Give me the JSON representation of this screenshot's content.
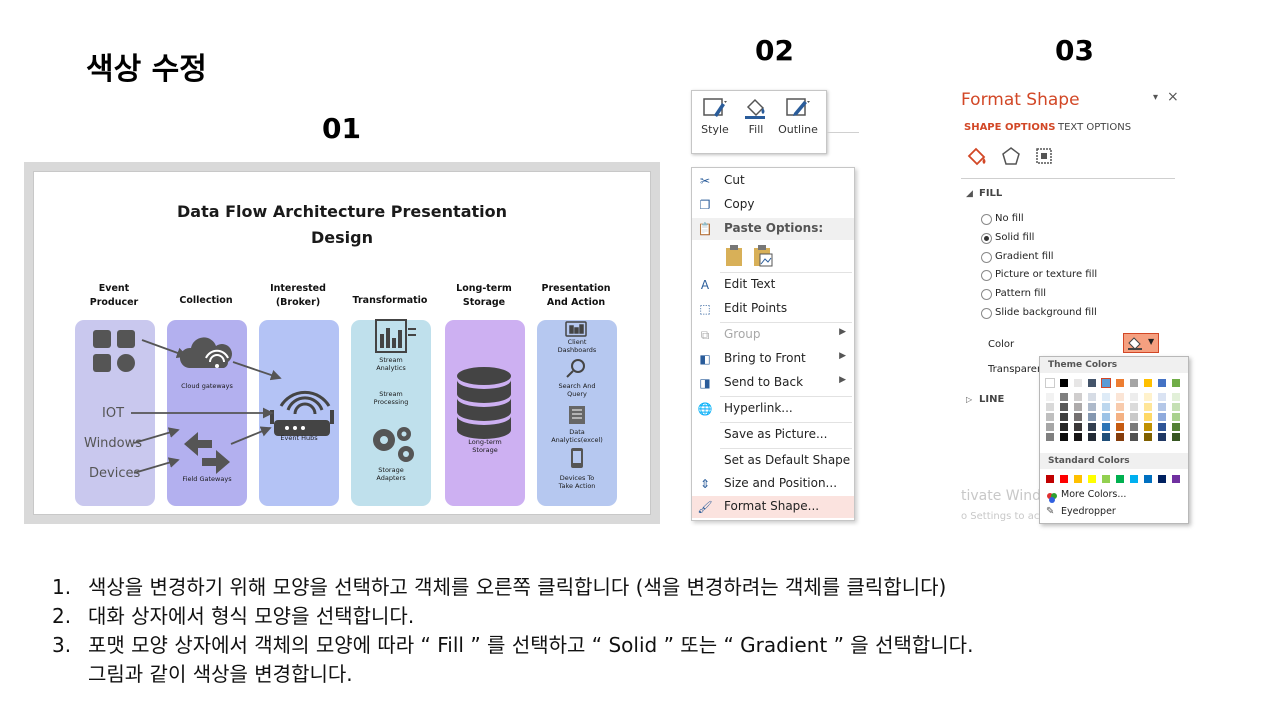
{
  "slide": {
    "main_title": "색상 수정",
    "label_01": "01",
    "label_02": "02",
    "label_03": "03"
  },
  "panel1": {
    "title_line1": "Data Flow Architecture Presentation",
    "title_line2": "Design",
    "columns": [
      {
        "header": "Event\nProducer",
        "color": "#c9c8ee"
      },
      {
        "header": "Collection",
        "color": "#b3b0ef"
      },
      {
        "header": "Interested\n(Broker)",
        "color": "#b4c3f5"
      },
      {
        "header": "Transformatio",
        "color": "#bfe0ec"
      },
      {
        "header": "Long-term\nStorage",
        "color": "#cdb0f2"
      },
      {
        "header": "Presentation\nAnd Action",
        "color": "#b6c8f0"
      }
    ],
    "left_labels": [
      "IOT",
      "Windows",
      "Devices"
    ],
    "captions": {
      "cloud_gateways": "Cloud gateways",
      "field_gateways": "Field Gateways",
      "event_hubs": "Event Hubs",
      "stream_analytics": "Stream\nAnalytics",
      "stream_processing": "Stream\nProcessing",
      "storage_adapters": "Storage\nAdapters",
      "long_term_storage": "Long-term\nStorage",
      "client_dashboards": "Client\nDashboards",
      "search_query": "Search And\nQuery",
      "data_analytics": "Data\nAnalytics(excel)",
      "devices_action": "Devices To\nTake Action"
    }
  },
  "panel2": {
    "ribbon": {
      "style": "Style",
      "fill": "Fill",
      "outline": "Outline"
    },
    "menu": {
      "cut": "Cut",
      "copy": "Copy",
      "paste_options": "Paste Options:",
      "edit_text": "Edit Text",
      "edit_points": "Edit Points",
      "group": "Group",
      "bring_to_front": "Bring to Front",
      "send_to_back": "Send to Back",
      "hyperlink": "Hyperlink...",
      "save_as_picture": "Save as Picture...",
      "set_default_shape": "Set as Default Shape",
      "size_position": "Size and Position...",
      "format_shape": "Format Shape..."
    }
  },
  "panel3": {
    "title": "Format Shape",
    "tab_shape": "SHAPE OPTIONS",
    "tab_text": "TEXT OPTIONS",
    "section_fill": "FILL",
    "fill_options": [
      "No fill",
      "Solid fill",
      "Gradient fill",
      "Picture or texture fill",
      "Pattern fill",
      "Slide background fill"
    ],
    "color_label": "Color",
    "transparency_label": "Transparen",
    "section_line": "LINE",
    "theme_colors": "Theme Colors",
    "standard_colors": "Standard Colors",
    "more_colors": "More Colors...",
    "eyedropper": "Eyedropper",
    "watermark1": "tivate Windows",
    "watermark2": "o Settings to activate Windows.",
    "accent_color": "#d24726"
  },
  "steps": [
    {
      "num": "1.",
      "text": "색상을 변경하기 위해 모양을 선택하고 객체를 오른쪽 클릭합니다 (색을 변경하려는 객체를 클릭합니다)"
    },
    {
      "num": "2.",
      "text": "대화 상자에서 형식 모양을 선택합니다."
    },
    {
      "num": "3.",
      "text": "포맷 모양 상자에서 객체의 모양에 따라 “ Fill ” 를 선택하고 “ Solid ” 또는 “ Gradient ” 을 선택합니다."
    },
    {
      "num": "",
      "text": "그림과 같이 색상을 변경합니다."
    }
  ]
}
